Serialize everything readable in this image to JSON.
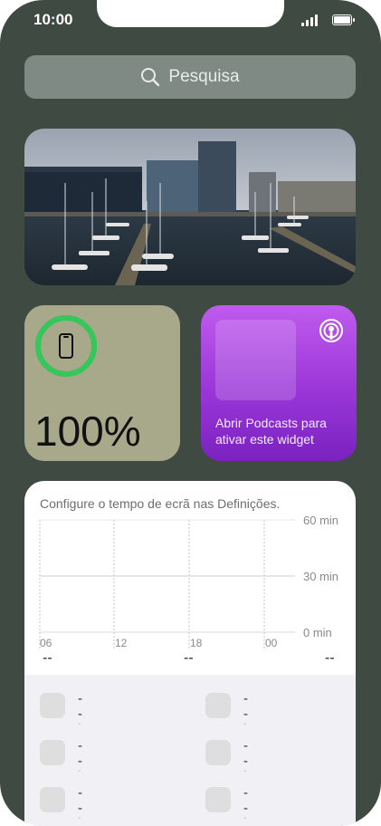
{
  "status": {
    "time": "10:00"
  },
  "search": {
    "label": "Pesquisa"
  },
  "battery_widget": {
    "level": 1.0,
    "percent_text": "100%",
    "ring_color": "#34c759"
  },
  "podcasts_widget": {
    "message": "Abrir Podcasts para ativar este widget"
  },
  "screen_time": {
    "hint": "Configure o tempo de ecrã nas Definições.",
    "y_ticks": [
      "60 min",
      "30 min",
      "0 min"
    ],
    "x_ticks": [
      "06",
      "12",
      "18",
      "00"
    ],
    "summary": [
      "--",
      "--",
      "--"
    ],
    "apps": [
      {
        "name": "--",
        "time": "--"
      },
      {
        "name": "--",
        "time": "--"
      },
      {
        "name": "--",
        "time": "--"
      },
      {
        "name": "--",
        "time": "--"
      },
      {
        "name": "--",
        "time": "--"
      },
      {
        "name": "--",
        "time": "--"
      }
    ]
  }
}
